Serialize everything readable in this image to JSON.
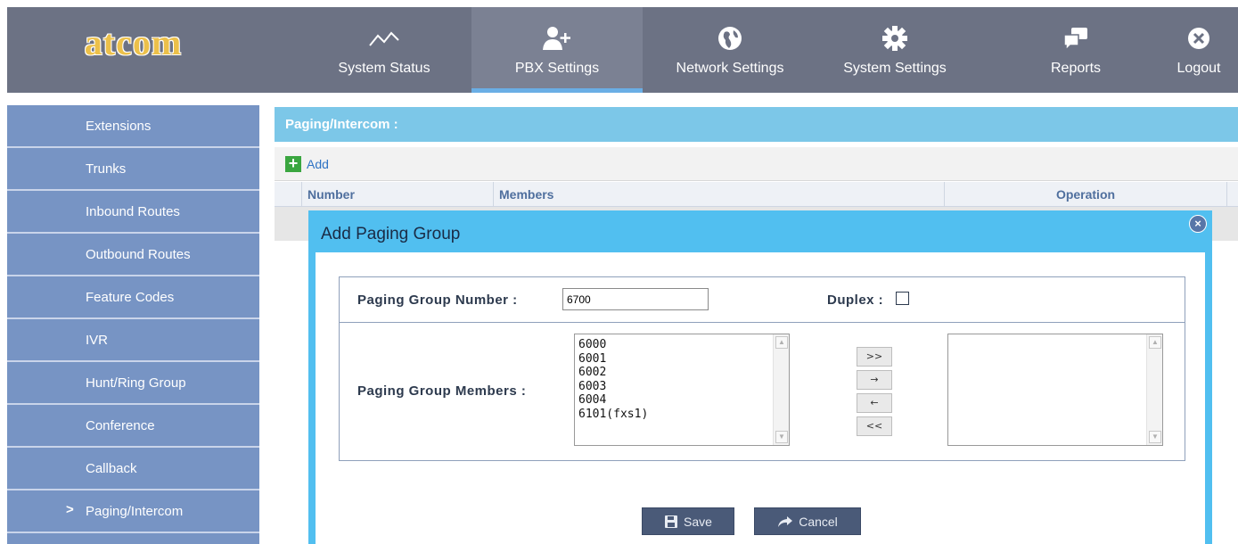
{
  "brand": {
    "logo_text": "atcom",
    "logo_color": "#ecc04a"
  },
  "nav": [
    {
      "label": "System Status",
      "icon": "line-chart-icon",
      "active": false
    },
    {
      "label": "PBX Settings",
      "icon": "add-user-icon",
      "active": true
    },
    {
      "label": "Network Settings",
      "icon": "globe-icon",
      "active": false
    },
    {
      "label": "System Settings",
      "icon": "gear-icon",
      "active": false
    },
    {
      "label": "Reports",
      "icon": "chat-icon",
      "active": false
    },
    {
      "label": "Logout",
      "icon": "close-circle-icon",
      "active": false
    }
  ],
  "sidebar": {
    "items": [
      {
        "label": "Extensions"
      },
      {
        "label": "Trunks"
      },
      {
        "label": "Inbound Routes"
      },
      {
        "label": "Outbound Routes"
      },
      {
        "label": "Feature Codes"
      },
      {
        "label": "IVR"
      },
      {
        "label": "Hunt/Ring Group"
      },
      {
        "label": "Conference"
      },
      {
        "label": "Callback"
      },
      {
        "label": "Paging/Intercom",
        "active": true
      }
    ],
    "active_marker": ">"
  },
  "section": {
    "title": "Paging/Intercom :"
  },
  "toolbar": {
    "add_label": "Add",
    "add_icon": "+"
  },
  "table": {
    "columns": [
      "Number",
      "Members",
      "Operation"
    ]
  },
  "dialog": {
    "title": "Add Paging Group",
    "close_icon": "×",
    "group_number_label": "Paging Group Number :",
    "group_number_value": "6700",
    "duplex_label": "Duplex :",
    "members_label": "Paging Group Members :",
    "available_members": [
      "6000",
      "6001",
      "6002",
      "6003",
      "6004",
      "6101(fxs1)"
    ],
    "selected_members": [],
    "move_buttons": [
      ">>",
      "→",
      "←",
      "<<"
    ],
    "save_label": "Save",
    "cancel_label": "Cancel"
  },
  "colors": {
    "header_bg": "#6c7284",
    "sidebar_bg": "#7794c4",
    "section_bar": "#7cc7e8",
    "dialog_frame": "#51bff0",
    "active_underline": "#6aaee5"
  }
}
